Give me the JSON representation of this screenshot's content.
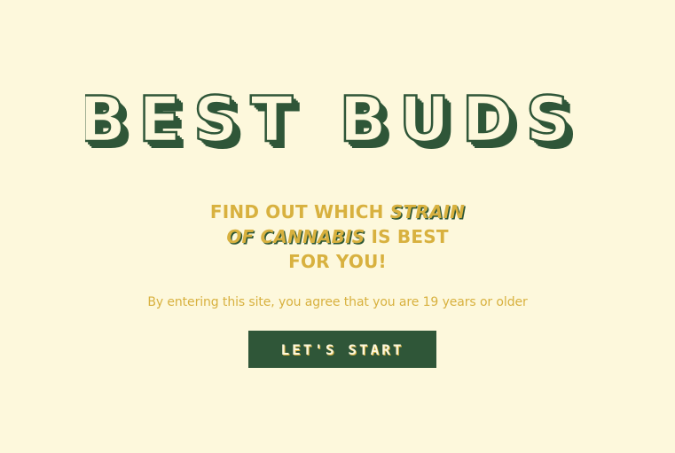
{
  "brand": {
    "logo_text": "BEST BUDS"
  },
  "hero": {
    "line1_plain": "FIND OUT WHICH ",
    "line1_emphasis": "STRAIN",
    "line2_emphasis": "OF CANNABIS",
    "line2_plain": " IS BEST",
    "line3": "FOR YOU!"
  },
  "disclaimer": "By entering this site, you agree that you are 19 years or older",
  "cta": {
    "label": "LET'S START"
  },
  "colors": {
    "background": "#fdf8dc",
    "brand_green": "#2f5638",
    "accent_gold": "#d8b13f"
  }
}
